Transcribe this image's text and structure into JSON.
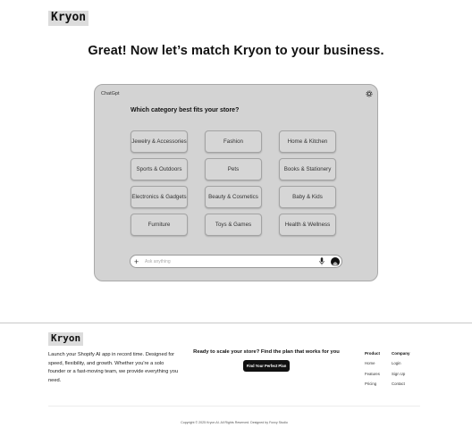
{
  "brand": {
    "logo_text": "Kryon"
  },
  "main": {
    "headline": "Great! Now let’s match Kryon to your business."
  },
  "chat": {
    "brand_label": "ChatGpt",
    "settings_icon": "gear-icon",
    "question": "Which category best fits your store?",
    "categories": [
      "Jewelry & Accessories",
      "Fashion",
      "Home & Kitchen",
      "Sports & Outdoors",
      "Pets",
      "Books & Stationery",
      "Electronics & Gadgets",
      "Beauty & Cosmetics",
      "Baby & Kids",
      "Furniture",
      "Toys & Games",
      "Health & Wellness"
    ],
    "input": {
      "placeholder": "Ask anything",
      "icons": [
        "plus-icon",
        "mic-icon",
        "send-icon"
      ]
    }
  },
  "footer": {
    "logo_text": "Kryon",
    "description": "Launch your Shopify AI app in record time. Designed for speed, flexibility, and growth. Whether you're a solo founder or a fast-moving team, we provide everything you need.",
    "cta_text": "Ready to scale your store? Find the plan that works for you",
    "cta_button": "Find Your Perfect Plan",
    "columns": [
      {
        "heading": "Product",
        "links": [
          "Home",
          "Features",
          "Pricing"
        ]
      },
      {
        "heading": "Company",
        "links": [
          "Login",
          "Sign Up",
          "Contact"
        ]
      }
    ],
    "copyright": "Copyright © 2025 Kryon AI. All Rights Reserved. Designed by Foxxy Studio"
  }
}
